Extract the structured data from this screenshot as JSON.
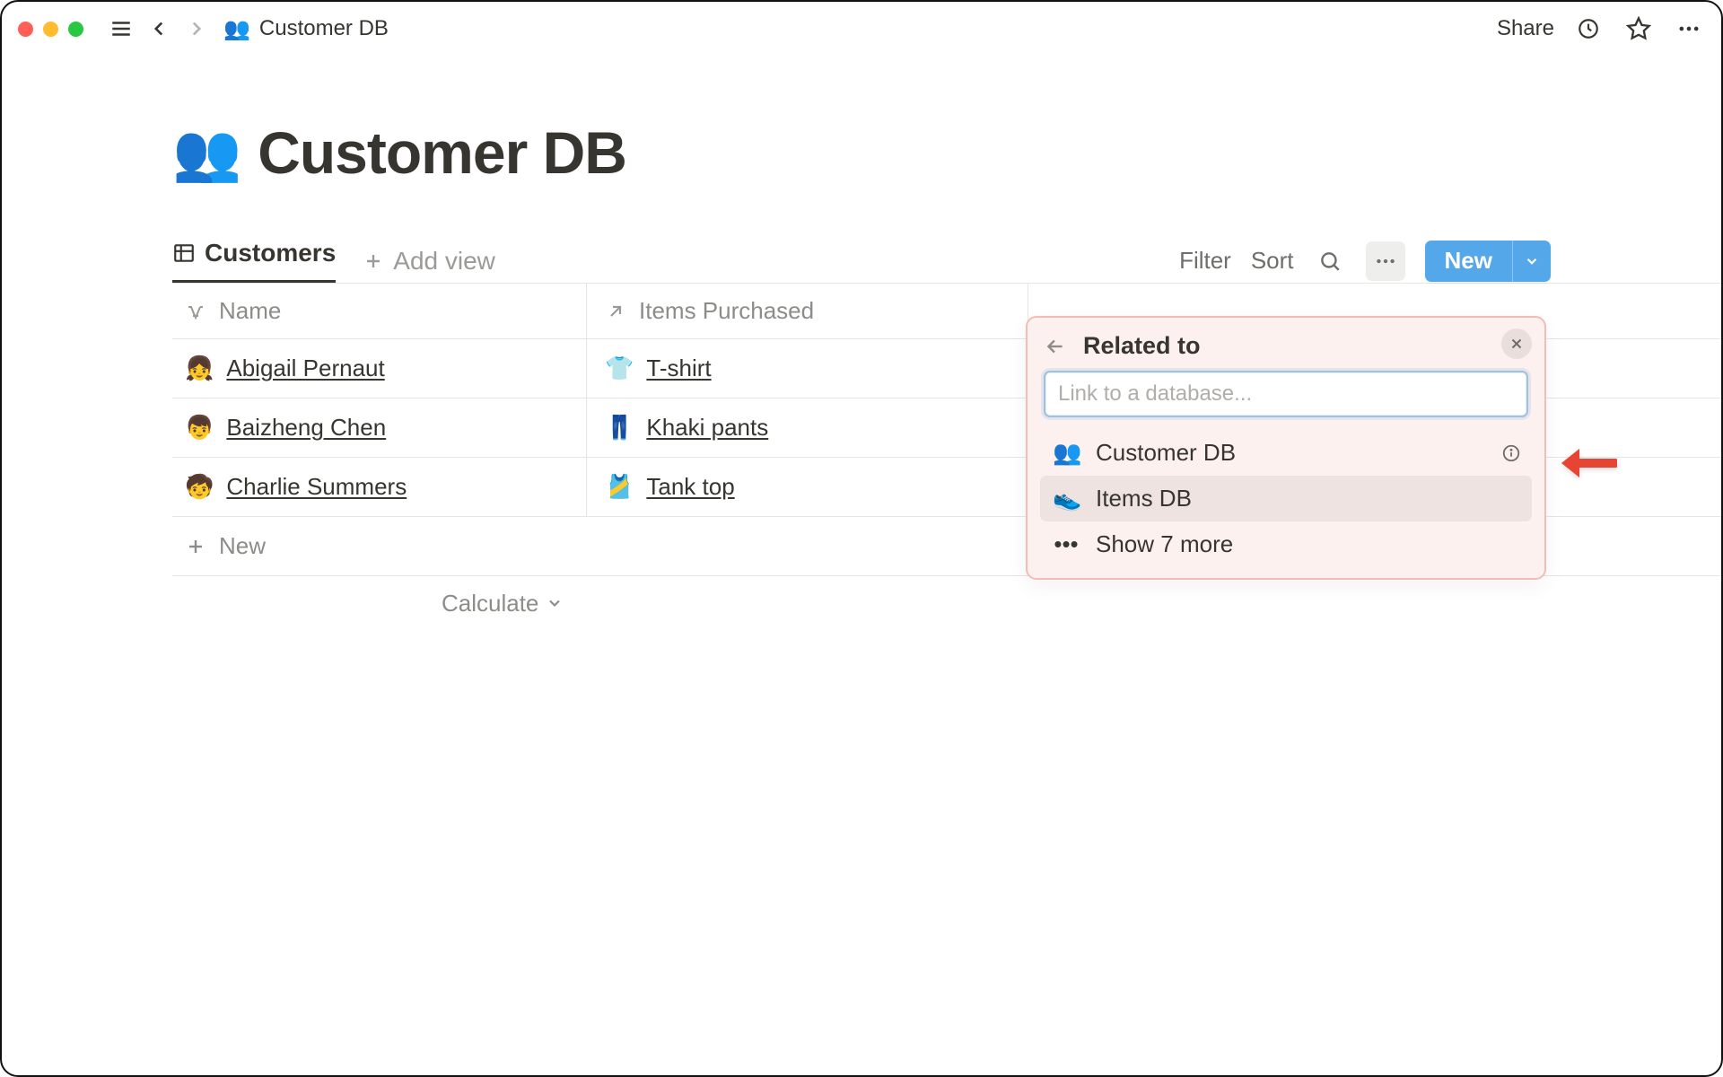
{
  "breadcrumb": {
    "icon": "👥",
    "title": "Customer DB"
  },
  "topbar": {
    "share": "Share"
  },
  "page": {
    "icon": "👥",
    "title": "Customer DB"
  },
  "views": {
    "active": "Customers",
    "addView": "Add view",
    "filter": "Filter",
    "sort": "Sort",
    "new": "New"
  },
  "columns": {
    "name": "Name",
    "items": "Items Purchased"
  },
  "rows": [
    {
      "avatar": "👧",
      "name": "Abigail Pernaut",
      "itemEmoji": "👕",
      "item": "T-shirt"
    },
    {
      "avatar": "👦",
      "name": "Baizheng Chen",
      "itemEmoji": "👖",
      "item": "Khaki pants"
    },
    {
      "avatar": "🧒",
      "name": "Charlie Summers",
      "itemEmoji": "🎽",
      "item": "Tank top"
    }
  ],
  "addRow": "New",
  "calculate": "Calculate",
  "popover": {
    "title": "Related to",
    "placeholder": "Link to a database...",
    "options": [
      {
        "icon": "👥",
        "label": "Customer DB",
        "info": true
      },
      {
        "icon": "👟",
        "label": "Items DB",
        "hover": true
      },
      {
        "icon": "•••",
        "label": "Show 7 more"
      }
    ]
  }
}
